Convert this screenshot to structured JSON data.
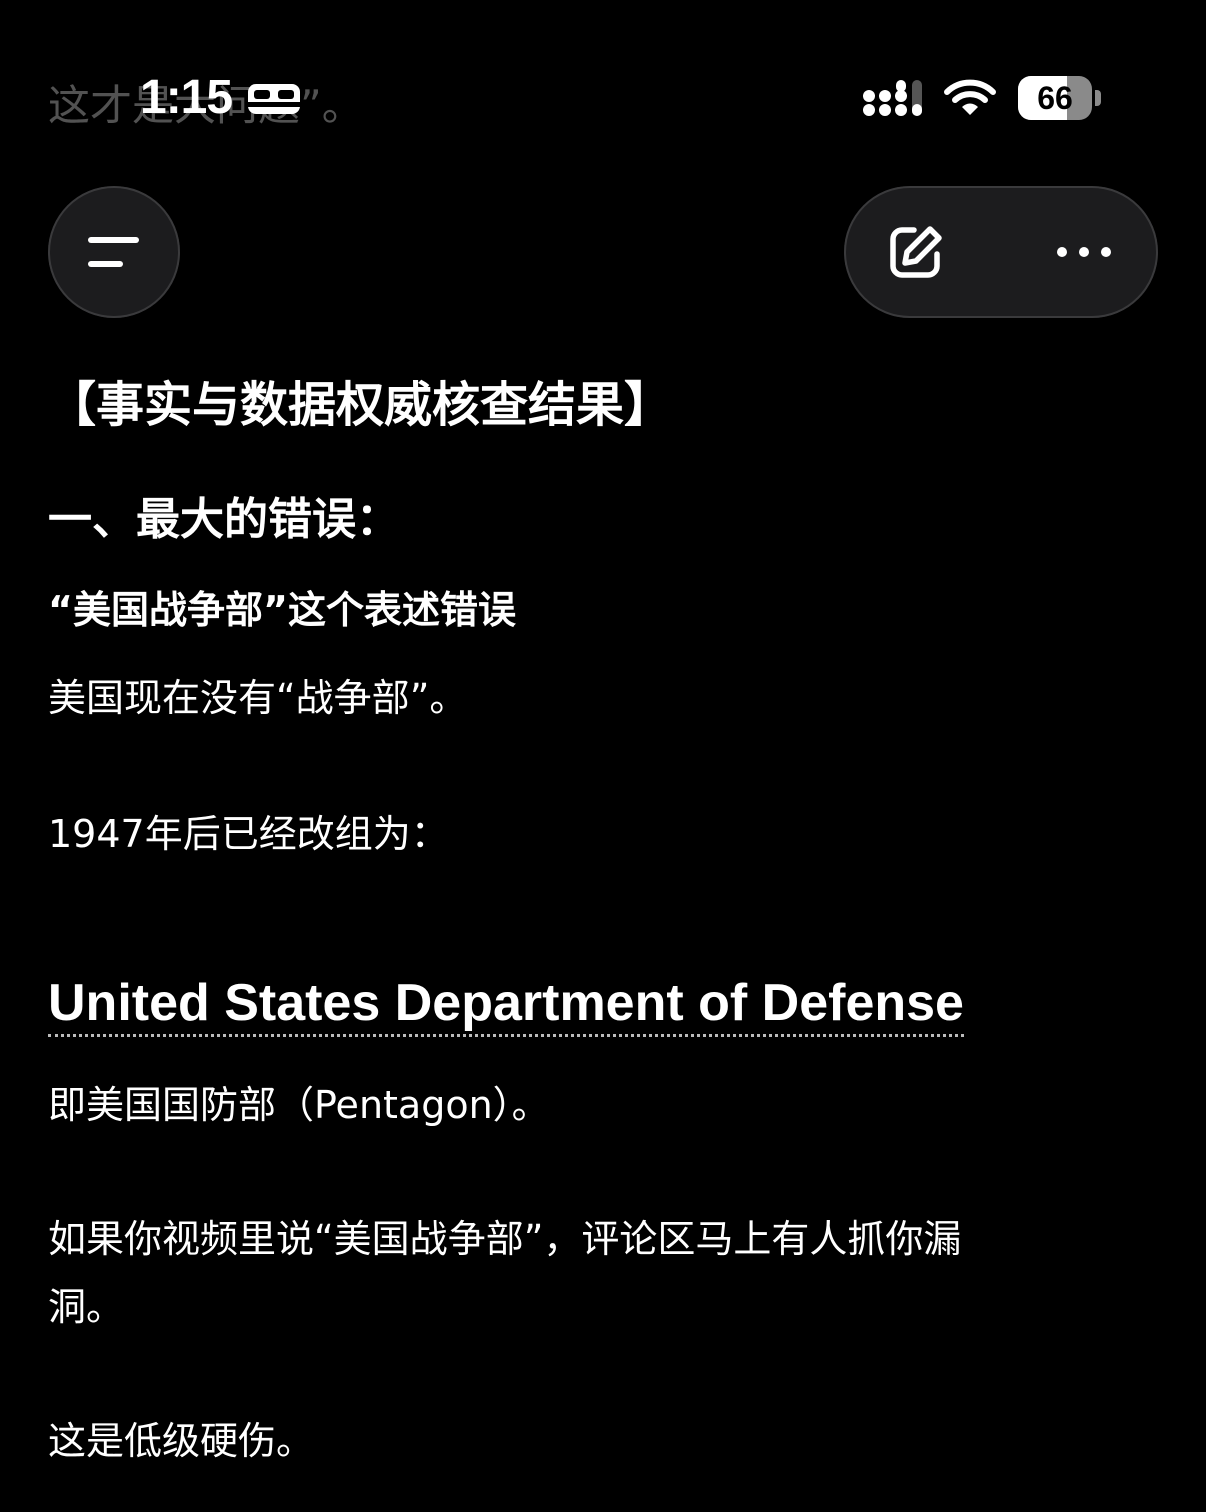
{
  "scrolled_text": "这才是大问题”。",
  "status_bar": {
    "time": "1:15",
    "battery_percent": 66,
    "battery_label": "66"
  },
  "toolbar": {
    "menu_icon": "menu-lines-icon",
    "edit_icon": "compose-icon",
    "more_icon": "ellipsis-icon"
  },
  "content": {
    "heading": "【事实与数据权威核查结果】",
    "section_title": "一、最大的错误：",
    "subtitle": "“美国战争部”这个表述错误",
    "paragraph_1": "美国现在没有“战争部”。",
    "paragraph_2": "1947年后已经改组为：",
    "link_heading": "United States Department of Defense",
    "paragraph_3": "即美国国防部（Pentagon）。",
    "paragraph_4": "如果你视频里说“美国战争部”，评论区马上有人抓你漏洞。",
    "paragraph_5": "这是低级硬伤。"
  }
}
